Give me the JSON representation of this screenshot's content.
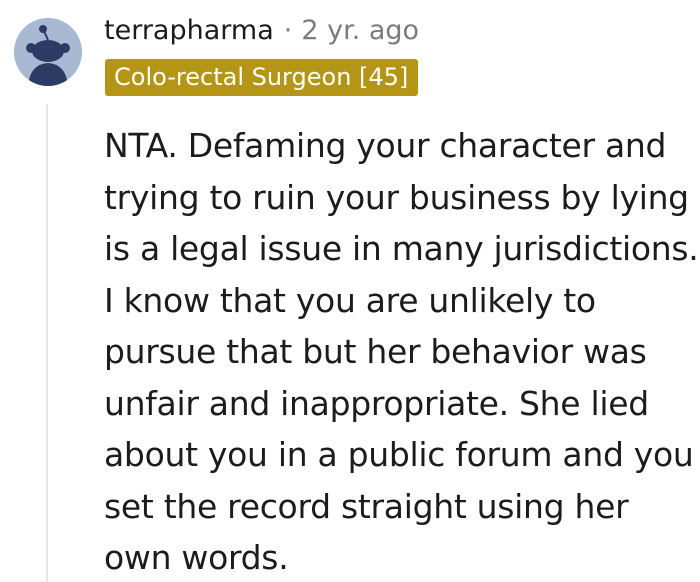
{
  "comment": {
    "username": "terrapharma",
    "separator": "·",
    "timestamp": "2 yr. ago",
    "flair": "Colo-rectal Surgeon [45]",
    "body_lines": [
      "NTA. Defaming your character and",
      "trying to ruin your business by lying",
      "is a legal issue in many jurisdictions.",
      "I know that you are unlikely to",
      "pursue that but her behavior was",
      "unfair and inappropriate. She lied",
      "about you in a public forum and you",
      "set the record straight using her",
      "own words."
    ],
    "avatar_icon": "snoo-avatar-icon"
  },
  "colors": {
    "flair_bg": "#b49515",
    "flair_text": "#ffffff",
    "avatar_bg": "#a9b9d3",
    "text": "#1c1c1c",
    "meta_gray": "#7c7c7c",
    "thread_line": "#e5e5e5"
  }
}
